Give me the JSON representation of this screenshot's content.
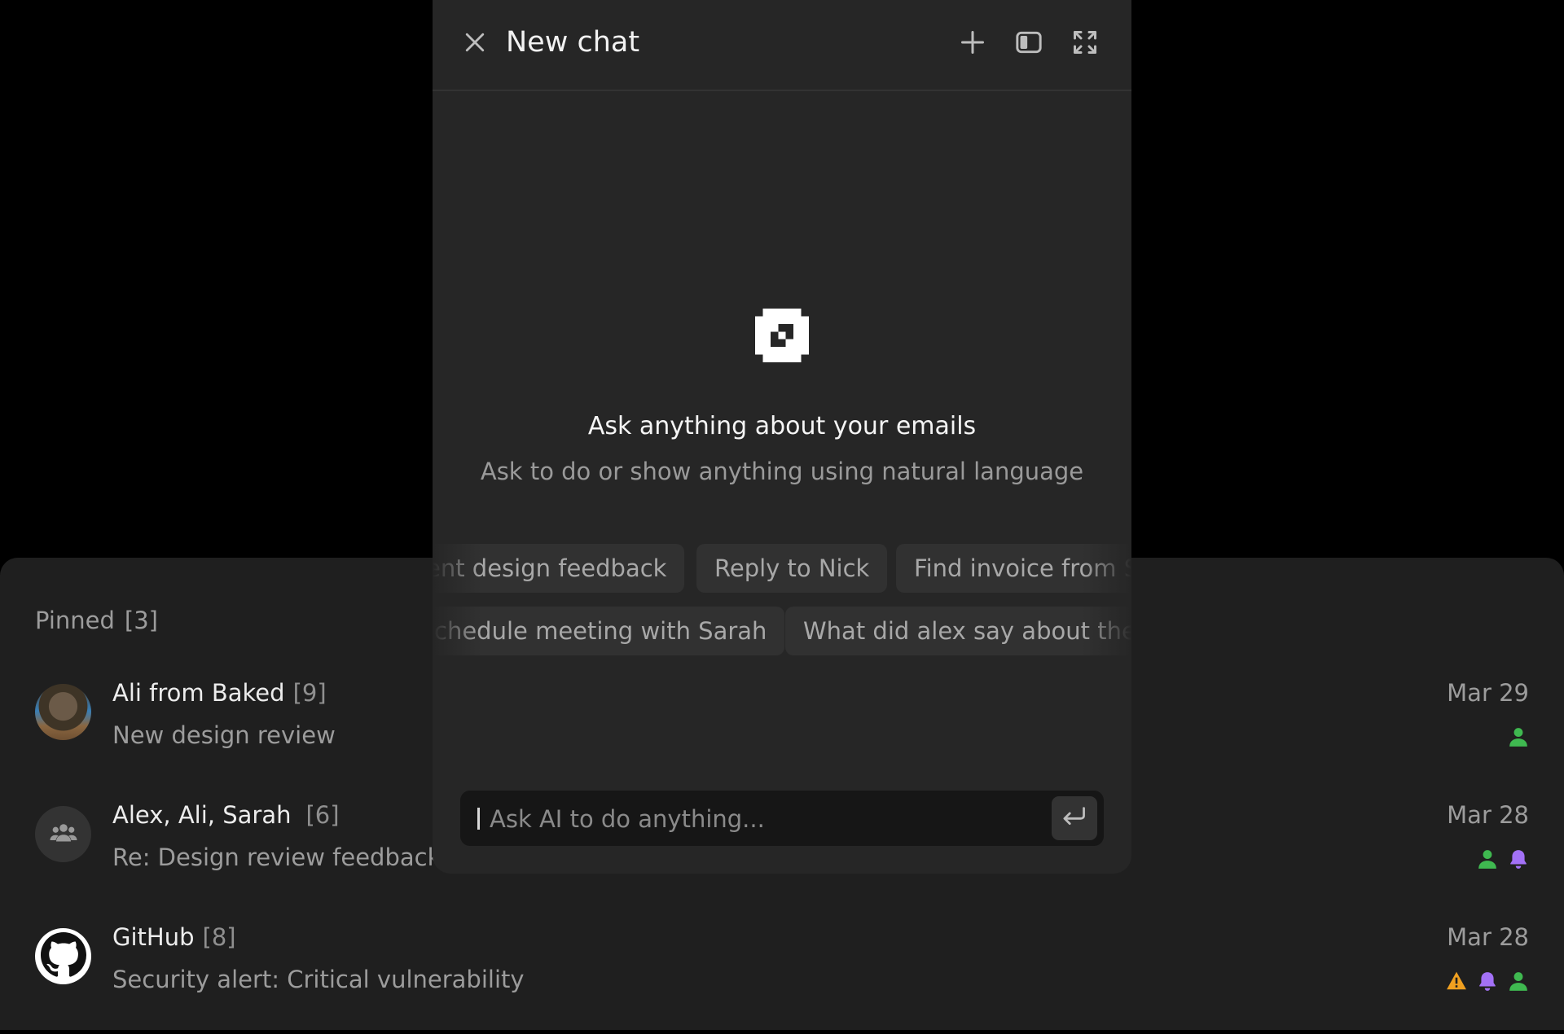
{
  "inbox": {
    "pinned_label": "Pinned",
    "pinned_count": "[3]",
    "rows": [
      {
        "sender": "Ali from Baked",
        "thread_count": "[9]",
        "subject": "New design review",
        "date": "Mar 29",
        "status_icons": [
          "person-icon"
        ]
      },
      {
        "sender": "Alex, Ali, Sarah",
        "thread_count": "[6]",
        "subject": "Re: Design review feedback",
        "date": "Mar 28",
        "status_icons": [
          "person-icon",
          "bell-icon"
        ]
      },
      {
        "sender": "GitHub",
        "thread_count": "[8]",
        "subject": "Security alert: Critical vulnerability",
        "date": "Mar 28",
        "status_icons": [
          "warning-icon",
          "bell-icon",
          "person-icon"
        ]
      }
    ]
  },
  "chat": {
    "title": "New chat",
    "heading": "Ask anything about your emails",
    "subheading": "Ask to do or show anything using natural language",
    "suggestions_row1": [
      "ent design feedback",
      "Reply to Nick",
      "Find invoice from S"
    ],
    "suggestions_row2": [
      "chedule meeting with Sarah",
      "What did alex say about the d"
    ],
    "input_placeholder": "Ask AI to do anything..."
  },
  "colors": {
    "background": "#000000",
    "panel": "#1f1f1f",
    "modal": "#262626",
    "status_green": "#3fb950",
    "status_purple": "#a371f7",
    "status_orange": "#f0a020"
  }
}
